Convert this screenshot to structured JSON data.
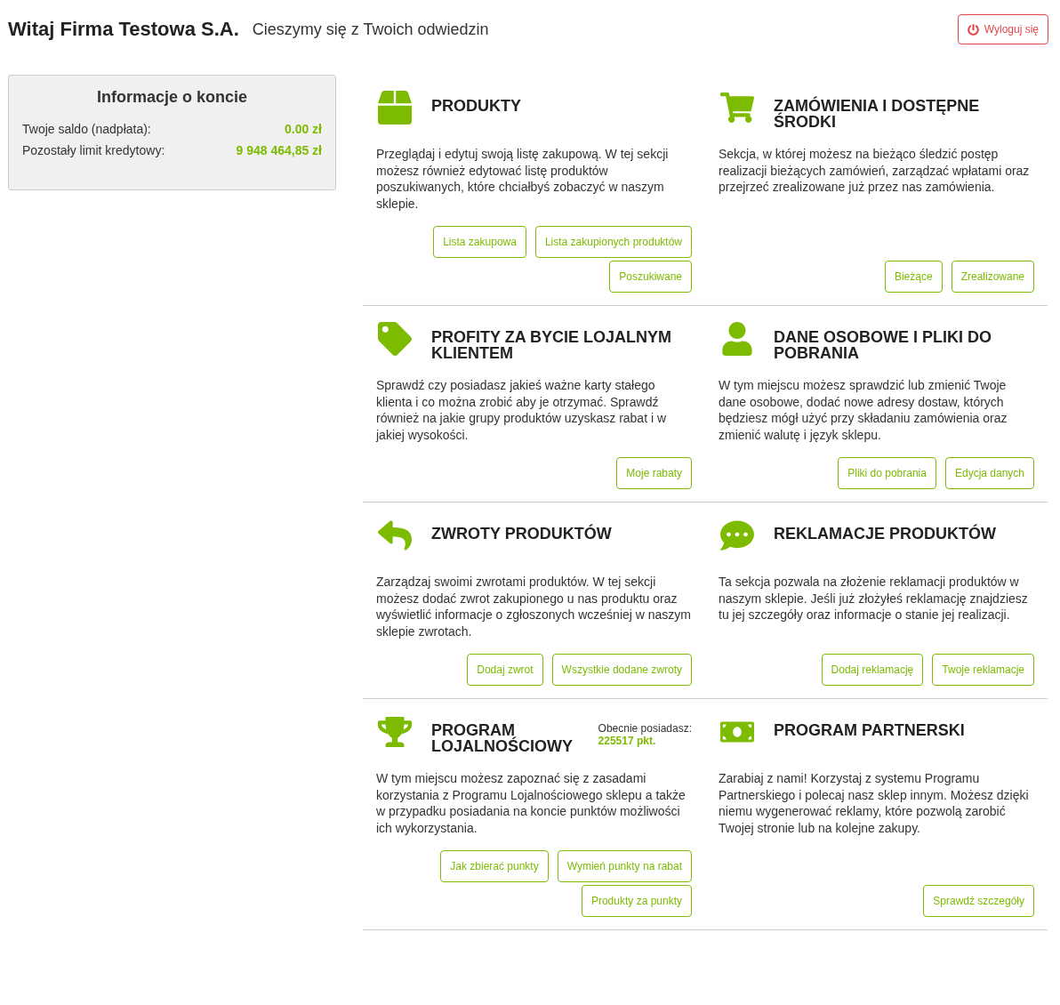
{
  "header": {
    "greeting": "Witaj Firma Testowa S.A.",
    "subtitle": "Cieszymy się z Twoich odwiedzin",
    "logout": "Wyloguj się"
  },
  "account": {
    "title": "Informacje o koncie",
    "rows": [
      {
        "label": "Twoje saldo (nadpłata):",
        "value": "0.00 zł"
      },
      {
        "label": "Pozostały limit kredytowy:",
        "value": "9 948 464,85 zł"
      }
    ]
  },
  "rows": [
    {
      "sections": [
        {
          "title": "PRODUKTY",
          "description": "Przeglądaj i edytuj swoją listę zakupową. W tej sekcji możesz również edytować listę produktów poszukiwanych, które chciałbyś zobaczyć w naszym sklepie.",
          "buttons": [
            "Lista zakupowa",
            "Lista zakupionych produktów",
            "Poszukiwane"
          ]
        },
        {
          "title": "ZAMÓWIENIA I DOSTĘPNE ŚRODKI",
          "description": "Sekcja, w której możesz na bieżąco śledzić postęp realizacji bieżących zamówień, zarządzać wpłatami oraz przejrzeć zrealizowane już przez nas zamówienia.",
          "buttons": [
            "Bieżące",
            "Zrealizowane"
          ]
        }
      ]
    },
    {
      "sections": [
        {
          "title": "PROFITY ZA BYCIE LOJALNYM KLIENTEM",
          "description": "Sprawdź czy posiadasz jakieś ważne karty stałego klienta i co można zrobić aby je otrzymać. Sprawdź również na jakie grupy produktów uzyskasz rabat i w jakiej wysokości.",
          "buttons": [
            "Moje rabaty"
          ]
        },
        {
          "title": "DANE OSOBOWE I PLIKI DO POBRANIA",
          "description": "W tym miejscu możesz sprawdzić lub zmienić Twoje dane osobowe, dodać nowe adresy dostaw, których będziesz mógł użyć przy składaniu zamówienia oraz zmienić walutę i język sklepu.",
          "buttons": [
            "Pliki do pobrania",
            "Edycja danych"
          ]
        }
      ]
    },
    {
      "sections": [
        {
          "title": "ZWROTY PRODUKTÓW",
          "description": "Zarządzaj swoimi zwrotami produktów. W tej sekcji możesz dodać zwrot zakupionego u nas produktu oraz wyświetlić informacje o zgłoszonych wcześniej w naszym sklepie zwrotach.",
          "buttons": [
            "Dodaj zwrot",
            "Wszystkie dodane zwroty"
          ]
        },
        {
          "title": "REKLAMACJE PRODUKTÓW",
          "description": "Ta sekcja pozwala na złożenie reklamacji produktów w naszym sklepie. Jeśli już złożyłeś reklamację znajdziesz tu jej szczegóły oraz informacje o stanie jej realizacji.",
          "buttons": [
            "Dodaj reklamację",
            "Twoje reklamacje"
          ]
        }
      ]
    },
    {
      "sections": [
        {
          "title": "PROGRAM LOJALNOŚCIOWY",
          "points": {
            "label": "Obecnie posiadasz:",
            "value": "225517 pkt."
          },
          "description": "W tym miejscu możesz zapoznać się z zasadami korzystania z Programu Lojalnościowego sklepu a także w przypadku posiadania na koncie punktów możliwości ich wykorzystania.",
          "buttons": [
            "Jak zbierać punkty",
            "Wymień punkty na rabat",
            "Produkty za punkty"
          ]
        },
        {
          "title": "PROGRAM PARTNERSKI",
          "description": "Zarabiaj z nami! Korzystaj z systemu Programu Partnerskiego i polecaj nasz sklep innym. Możesz dzięki niemu wygenerować reklamy, które pozwolą zarobić Twojej stronie lub na kolejne zakupy.",
          "buttons": [
            "Sprawdź szczegóły"
          ]
        }
      ]
    }
  ]
}
